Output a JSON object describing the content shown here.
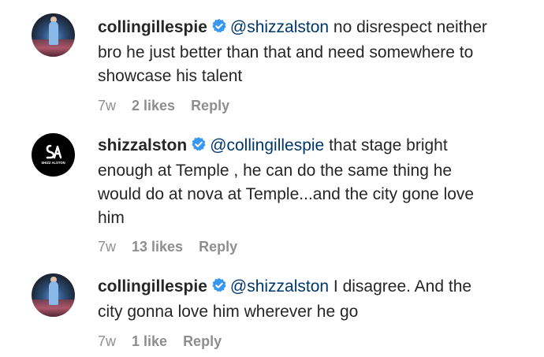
{
  "comments": [
    {
      "avatar_icon": "profile-photo-basketball",
      "username": "collingillespie",
      "verified_icon": "verified-badge-icon",
      "mention": "@shizzalston",
      "text": "no disrespect neither bro he just better than that and need somewhere to showcase his talent",
      "time": "7w",
      "likes": "2 likes",
      "reply": "Reply"
    },
    {
      "avatar_icon": "shizz-alston-logo",
      "avatar_logo_text": "SHIZZ ALSTON",
      "username": "shizzalston",
      "verified_icon": "verified-badge-icon",
      "mention": "@collingillespie",
      "text": "that stage bright enough at Temple , he can do the same thing he would do at nova at Temple...and the city gone love him",
      "time": "7w",
      "likes": "13 likes",
      "reply": "Reply"
    },
    {
      "avatar_icon": "profile-photo-basketball",
      "username": "collingillespie",
      "verified_icon": "verified-badge-icon",
      "mention": "@shizzalston",
      "text": "I disagree. And the city gonna love him wherever he go",
      "time": "7w",
      "likes": "1 like",
      "reply": "Reply"
    }
  ],
  "colors": {
    "username": "#262626",
    "mention": "#00376b",
    "meta": "#8e8e8e",
    "verified": "#3897f0"
  }
}
